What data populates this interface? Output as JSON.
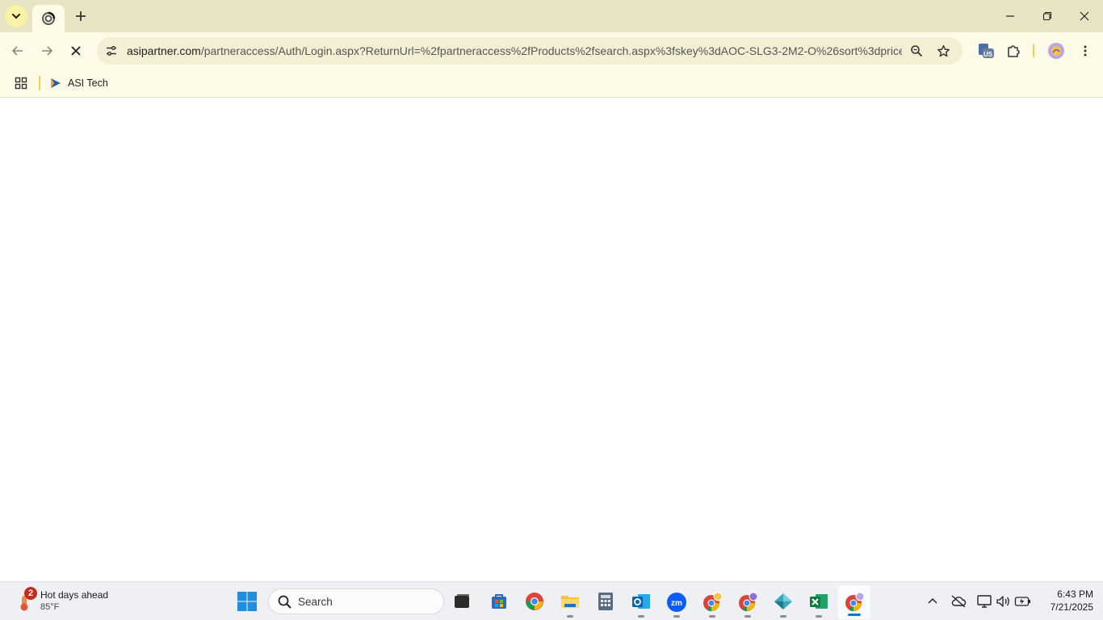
{
  "browser": {
    "url_host": "asipartner.com",
    "url_path": "/partneraccess/Auth/Login.aspx?ReturnUrl=%2fpartneraccess%2fProducts%2fsearch.aspx%3fskey%3dAOC-SLG3-2M2-O%26sort%3dprice-...",
    "extension_badge": "US",
    "accent": "#f0d34a",
    "chrome_bg": "#fdfbe8",
    "tabstrip_bg": "#e8e5c4"
  },
  "bookmarks": {
    "items": [
      {
        "label": "ASI Tech"
      }
    ]
  },
  "taskbar": {
    "weather": {
      "badge": "2",
      "title": "Hot days ahead",
      "temp": "85°F"
    },
    "search_label": "Search",
    "clock": {
      "time": "6:43 PM",
      "date": "7/21/2025"
    }
  }
}
